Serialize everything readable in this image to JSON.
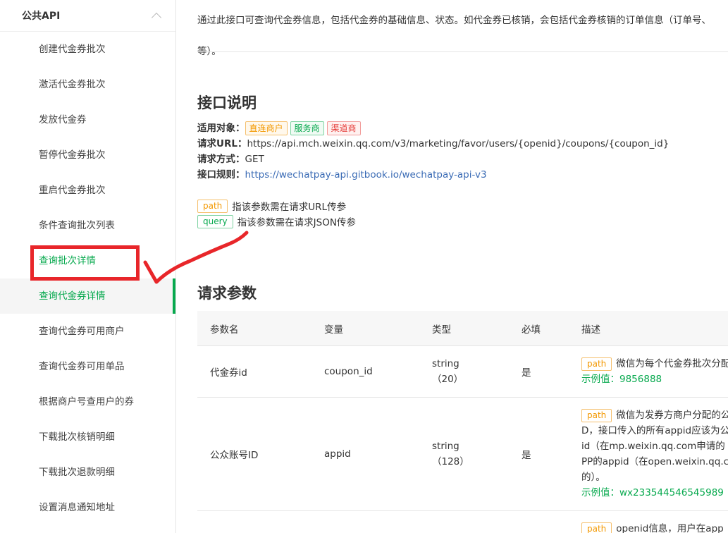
{
  "sidebar": {
    "section_title": "公共API",
    "items": [
      {
        "label": "创建代金券批次"
      },
      {
        "label": "激活代金券批次"
      },
      {
        "label": "发放代金券"
      },
      {
        "label": "暂停代金券批次"
      },
      {
        "label": "重启代金券批次"
      },
      {
        "label": "条件查询批次列表"
      },
      {
        "label": "查询批次详情"
      },
      {
        "label": "查询代金券详情"
      },
      {
        "label": "查询代金券可用商户"
      },
      {
        "label": "查询代金券可用单品"
      },
      {
        "label": "根据商户号查用户的券"
      },
      {
        "label": "下载批次核销明细"
      },
      {
        "label": "下载批次退款明细"
      },
      {
        "label": "设置消息通知地址"
      }
    ]
  },
  "intro": {
    "line1": "通过此接口可查询代金券信息，包括代金券的基础信息、状态。如代金券已核销，会包括代金券核销的订单信息（订单号、",
    "line2": "等）。"
  },
  "api": {
    "title": "接口说明",
    "target_label": "适用对象：",
    "target_tags": [
      "直连商户",
      "服务商",
      "渠道商"
    ],
    "url_label": "请求URL：",
    "url": "https://api.mch.weixin.qq.com/v3/marketing/favor/users/{openid}/coupons/{coupon_id}",
    "method_label": "请求方式：",
    "method": "GET",
    "rule_label": "接口规则：",
    "rule_link": "https://wechatpay-api.gitbook.io/wechatpay-api-v3"
  },
  "legend": {
    "path_tag": "path",
    "path_text": "指该参数需在请求URL传参",
    "query_tag": "query",
    "query_text": "指该参数需在请求JSON传参"
  },
  "params": {
    "title": "请求参数",
    "headers": [
      "参数名",
      "变量",
      "类型",
      "必填",
      "描述"
    ],
    "rows": [
      {
        "name": "代金券id",
        "var": "coupon_id",
        "type1": "string",
        "type2": "（20）",
        "required": "是",
        "tag": "path",
        "desc_lines": [
          "微信为每个代金券批次分配"
        ],
        "example": "示例值：9856888"
      },
      {
        "name": "公众账号ID",
        "var": "appid",
        "type1": "string",
        "type2": "（128）",
        "required": "是",
        "tag": "path",
        "desc_lines": [
          "微信为发券方商户分配的公",
          "D，接口传入的所有appid应该为公",
          "id（在mp.weixin.qq.com申请的",
          "PP的appid（在open.weixin.qq.c",
          "的）。"
        ],
        "example": "示例值：wx233544546545989"
      },
      {
        "tag": "path",
        "desc_lines": [
          "openid信息，用户在app"
        ]
      }
    ]
  }
}
